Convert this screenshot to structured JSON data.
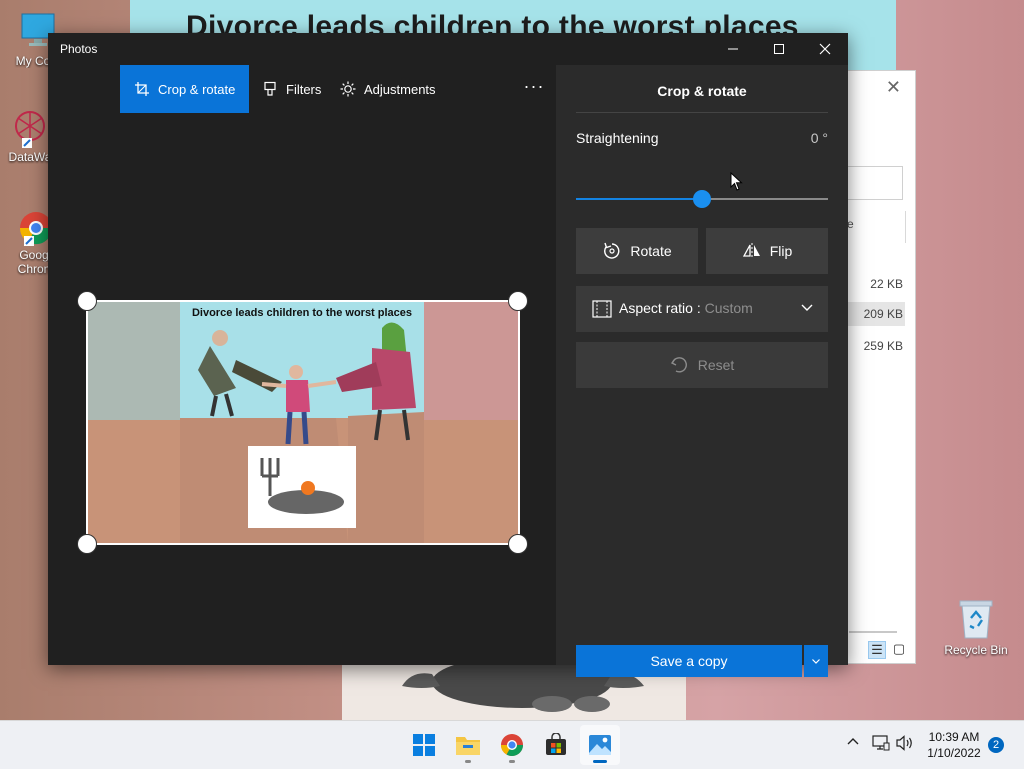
{
  "desktop": {
    "wallpaper_title": "Divorce leads children to the worst places",
    "icons": [
      {
        "label": "My Com",
        "name": "this-pc"
      },
      {
        "label": "DataWa",
        "name": "datawa"
      },
      {
        "label": "Goog Chron",
        "label1": "Goog",
        "label2": "Chron",
        "name": "google-chrome"
      }
    ],
    "recycle_label": "Recycle Bin"
  },
  "explorer": {
    "sizes": [
      "22 KB",
      "209 KB",
      "259 KB"
    ],
    "partial_text": "e"
  },
  "photos": {
    "window_title": "Photos",
    "toolbar": {
      "crop_rotate": "Crop & rotate",
      "filters": "Filters",
      "adjustments": "Adjustments",
      "more": "···"
    },
    "image_caption": "Divorce leads children to the worst places",
    "panel": {
      "title": "Crop & rotate",
      "straightening_label": "Straightening",
      "straightening_value": "0 °",
      "straightening_fraction": 0.5,
      "rotate": "Rotate",
      "flip": "Flip",
      "aspect_label": "Aspect ratio :",
      "aspect_value": "Custom",
      "reset": "Reset",
      "save": "Save a copy"
    }
  },
  "taskbar": {
    "apps": [
      "start",
      "file-explorer",
      "chrome",
      "microsoft-store",
      "photos"
    ],
    "time": "10:39 AM",
    "date": "1/10/2022",
    "notifications": "2"
  },
  "colors": {
    "accent": "#0a74d8",
    "window_bg": "#202020",
    "panel_bg": "#2b2b2b"
  }
}
